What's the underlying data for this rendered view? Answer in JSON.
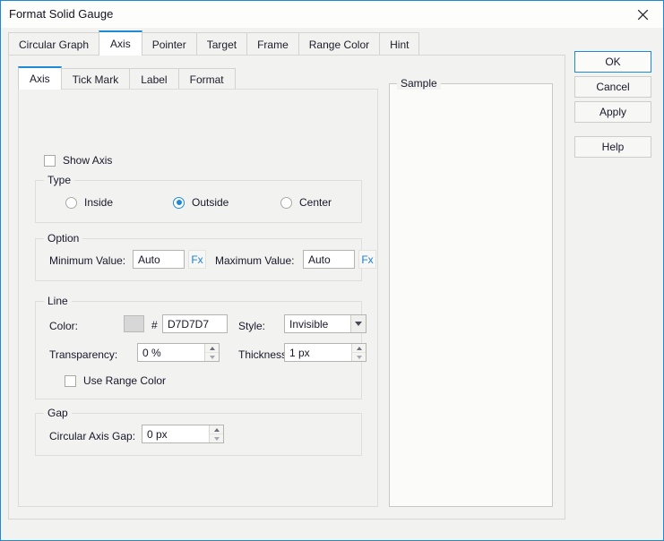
{
  "window": {
    "title": "Format Solid Gauge",
    "close_icon": "close-icon"
  },
  "main_tabs": [
    {
      "label": "Circular Graph",
      "active": false
    },
    {
      "label": "Axis",
      "active": true
    },
    {
      "label": "Pointer",
      "active": false
    },
    {
      "label": "Target",
      "active": false
    },
    {
      "label": "Frame",
      "active": false
    },
    {
      "label": "Range Color",
      "active": false
    },
    {
      "label": "Hint",
      "active": false
    }
  ],
  "sub_tabs": [
    {
      "label": "Axis",
      "active": true
    },
    {
      "label": "Tick Mark",
      "active": false
    },
    {
      "label": "Label",
      "active": false
    },
    {
      "label": "Format",
      "active": false
    }
  ],
  "axis": {
    "show_axis": {
      "label": "Show Axis",
      "checked": false
    },
    "type_group": {
      "title": "Type",
      "options": [
        {
          "label": "Inside",
          "selected": false
        },
        {
          "label": "Outside",
          "selected": true
        },
        {
          "label": "Center",
          "selected": false
        }
      ]
    },
    "option_group": {
      "title": "Option",
      "minimum_label": "Minimum Value:",
      "minimum_value": "Auto",
      "minimum_fx": "Fx",
      "maximum_label": "Maximum Value:",
      "maximum_value": "Auto",
      "maximum_fx": "Fx"
    },
    "line_group": {
      "title": "Line",
      "color_label": "Color:",
      "color_swatch": "#D7D7D7",
      "hash": "#",
      "color_value": "D7D7D7",
      "style_label": "Style:",
      "style_value": "Invisible",
      "transparency_label": "Transparency:",
      "transparency_value": "0 %",
      "thickness_label": "Thickness:",
      "thickness_value": "1 px",
      "use_range_color": {
        "label": "Use Range Color",
        "checked": false
      }
    },
    "gap_group": {
      "title": "Gap",
      "circular_axis_gap_label": "Circular Axis Gap:",
      "circular_axis_gap_value": "0 px"
    }
  },
  "sample": {
    "title": "Sample"
  },
  "buttons": {
    "ok": "OK",
    "cancel": "Cancel",
    "apply": "Apply",
    "help": "Help"
  },
  "colors": {
    "accent": "#1e8ad6",
    "window_bg": "#f2f2f0",
    "panel_bg": "#ffffff"
  }
}
